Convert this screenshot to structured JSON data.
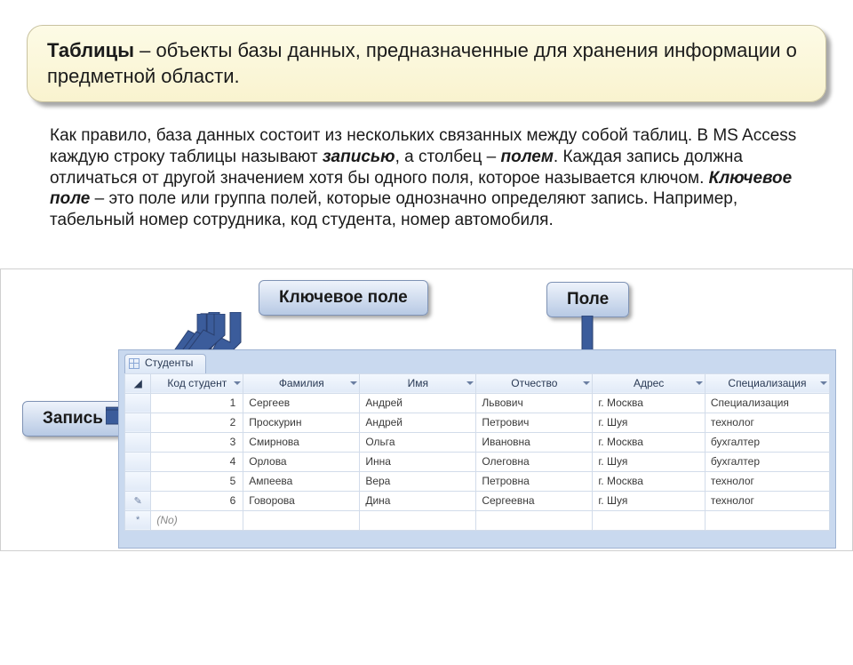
{
  "title": {
    "term": "Таблицы",
    "rest": " – объекты базы данных, предназначенные для хранения информации о предметной области."
  },
  "paragraph": {
    "p1": "Как правило, база данных состоит из нескольких связанных между собой таблиц. В MS Access каждую строку таблицы называют ",
    "em1": "записью",
    "p2": ", а столбец – ",
    "em2": "полем",
    "p3": ". Каждая запись должна отличаться от другой значением хотя бы одного поля, которое называется ключом. ",
    "bold1": "Ключевое поле",
    "p4": " – это поле или группа полей, которые однозначно определяют запись. Например, табельный номер сотрудника, код студента, номер автомобиля."
  },
  "callouts": {
    "key": "Ключевое поле",
    "field": "Поле",
    "record": "Запись"
  },
  "tab_label": "Студенты",
  "headers": [
    "Код студент",
    "Фамилия",
    "Имя",
    "Отчество",
    "Адрес",
    "Специализация"
  ],
  "rows": [
    {
      "id": "1",
      "c": [
        "Сергеев",
        "Андрей",
        "Львович",
        "г. Москва",
        "Специализация"
      ]
    },
    {
      "id": "2",
      "c": [
        "Проскурин",
        "Андрей",
        "Петрович",
        "г. Шуя",
        "технолог"
      ]
    },
    {
      "id": "3",
      "c": [
        "Смирнова",
        "Ольга",
        "Ивановна",
        "г. Москва",
        "бухгалтер"
      ]
    },
    {
      "id": "4",
      "c": [
        "Орлова",
        "Инна",
        "Олеговна",
        "г. Шуя",
        "бухгалтер"
      ]
    },
    {
      "id": "5",
      "c": [
        "Ампеева",
        "Вера",
        "Петровна",
        "г. Москва",
        "технолог"
      ]
    },
    {
      "id": "6",
      "c": [
        "Говорова",
        "Дина",
        "Сергеевна",
        "г. Шуя",
        "технолог"
      ]
    }
  ],
  "new_row_placeholder": "(No)",
  "row_marker_pencil": "✎",
  "row_marker_star": "*"
}
